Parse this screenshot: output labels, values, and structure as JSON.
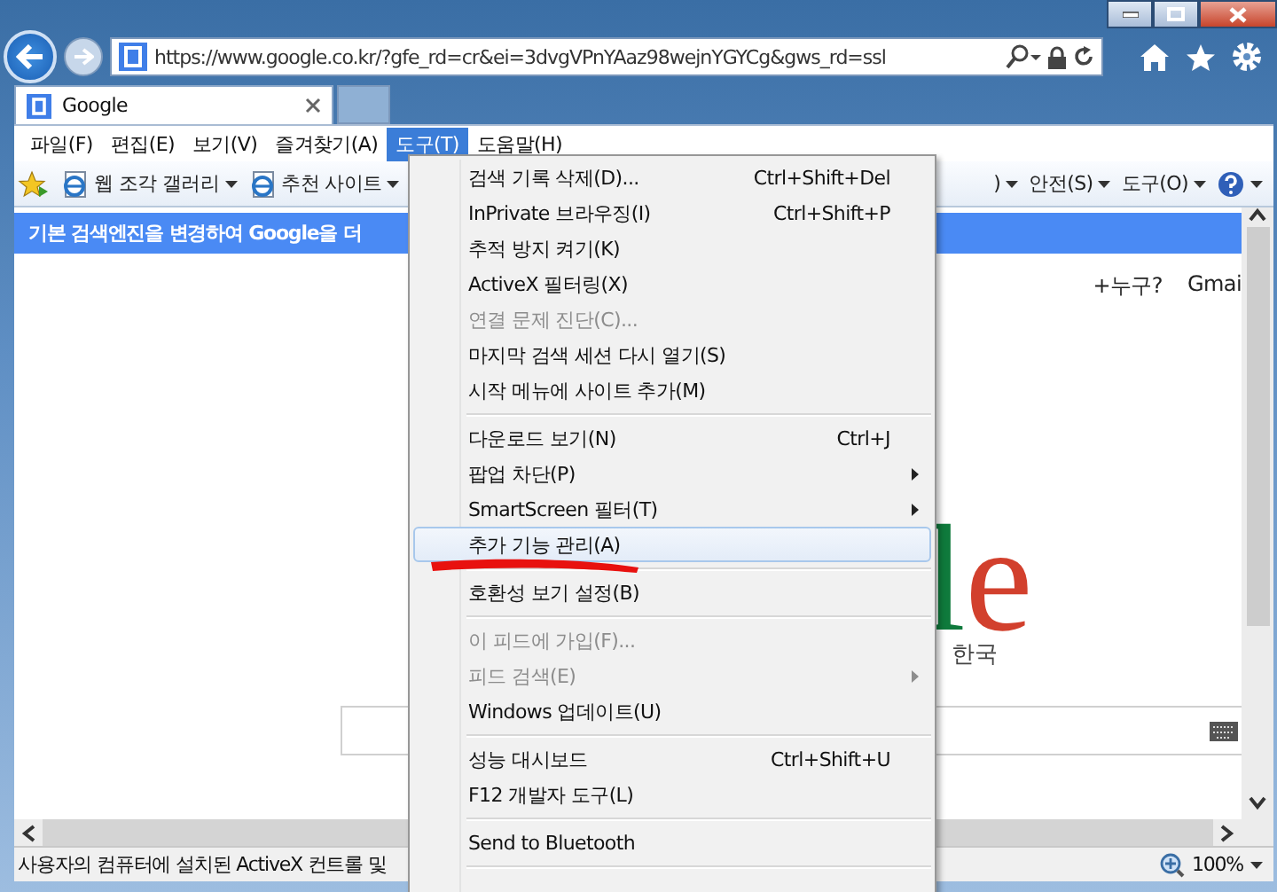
{
  "address_bar": {
    "url": "https://www.google.co.kr/?gfe_rd=cr&ei=3dvgVPnYAaz98wejnYGYCg&gws_rd=ssl"
  },
  "tabs": [
    {
      "label": "Google",
      "selected": true
    }
  ],
  "menu_bar": [
    {
      "label": "파일(F)",
      "selected": false
    },
    {
      "label": "편집(E)",
      "selected": false
    },
    {
      "label": "보기(V)",
      "selected": false
    },
    {
      "label": "즐겨찾기(A)",
      "selected": false
    },
    {
      "label": "도구(T)",
      "selected": true
    },
    {
      "label": "도움말(H)",
      "selected": false
    }
  ],
  "command_bar": {
    "left": [
      {
        "label": "웹 조각 갤러리"
      },
      {
        "label": "추천 사이트"
      }
    ],
    "right": [
      {
        "label": ")"
      },
      {
        "label": "안전(S)"
      },
      {
        "label": "도구(O)"
      }
    ]
  },
  "notification": "기본 검색엔진을 변경하여 Google을 더",
  "page": {
    "links": [
      "+누구?",
      "Gmai"
    ],
    "logo_letters": [
      {
        "char": "l",
        "color": "#0f7a3c"
      },
      {
        "char": "e",
        "color": "#d2402d"
      }
    ],
    "region": "한국"
  },
  "status_bar": {
    "text": "사용자의 컴퓨터에 설치된 ActiveX 컨트롤 및",
    "zoom": "100%"
  },
  "tools_menu": [
    {
      "kind": "item",
      "label": "검색 기록 삭제(D)...",
      "shortcut": "Ctrl+Shift+Del",
      "disabled": false,
      "submenu": false,
      "selected": false
    },
    {
      "kind": "item",
      "label": "InPrivate 브라우징(I)",
      "shortcut": "Ctrl+Shift+P",
      "disabled": false,
      "submenu": false,
      "selected": false
    },
    {
      "kind": "item",
      "label": "추적 방지 켜기(K)",
      "disabled": false,
      "submenu": false,
      "selected": false
    },
    {
      "kind": "item",
      "label": "ActiveX 필터링(X)",
      "disabled": false,
      "submenu": false,
      "selected": false
    },
    {
      "kind": "item",
      "label": "연결 문제 진단(C)...",
      "disabled": true,
      "submenu": false,
      "selected": false
    },
    {
      "kind": "item",
      "label": "마지막 검색 세션 다시 열기(S)",
      "disabled": false,
      "submenu": false,
      "selected": false
    },
    {
      "kind": "item",
      "label": "시작 메뉴에 사이트 추가(M)",
      "disabled": false,
      "submenu": false,
      "selected": false
    },
    {
      "kind": "separator"
    },
    {
      "kind": "item",
      "label": "다운로드 보기(N)",
      "shortcut": "Ctrl+J",
      "disabled": false,
      "submenu": false,
      "selected": false
    },
    {
      "kind": "item",
      "label": "팝업 차단(P)",
      "disabled": false,
      "submenu": true,
      "selected": false
    },
    {
      "kind": "item",
      "label": "SmartScreen 필터(T)",
      "disabled": false,
      "submenu": true,
      "selected": false
    },
    {
      "kind": "item",
      "label": "추가 기능 관리(A)",
      "disabled": false,
      "submenu": false,
      "selected": true,
      "underlined": true
    },
    {
      "kind": "separator"
    },
    {
      "kind": "item",
      "label": "호환성 보기 설정(B)",
      "disabled": false,
      "submenu": false,
      "selected": false
    },
    {
      "kind": "separator"
    },
    {
      "kind": "item",
      "label": "이 피드에 가입(F)...",
      "disabled": true,
      "submenu": false,
      "selected": false
    },
    {
      "kind": "item",
      "label": "피드 검색(E)",
      "disabled": true,
      "submenu": true,
      "selected": false
    },
    {
      "kind": "item",
      "label": "Windows 업데이트(U)",
      "disabled": false,
      "submenu": false,
      "selected": false
    },
    {
      "kind": "separator"
    },
    {
      "kind": "item",
      "label": "성능 대시보드",
      "shortcut": "Ctrl+Shift+U",
      "disabled": false,
      "submenu": false,
      "selected": false
    },
    {
      "kind": "item",
      "label": "F12 개발자 도구(L)",
      "disabled": false,
      "submenu": false,
      "selected": false
    },
    {
      "kind": "separator"
    },
    {
      "kind": "item",
      "label": "Send to Bluetooth",
      "disabled": false,
      "submenu": false,
      "selected": false
    },
    {
      "kind": "separator"
    }
  ]
}
